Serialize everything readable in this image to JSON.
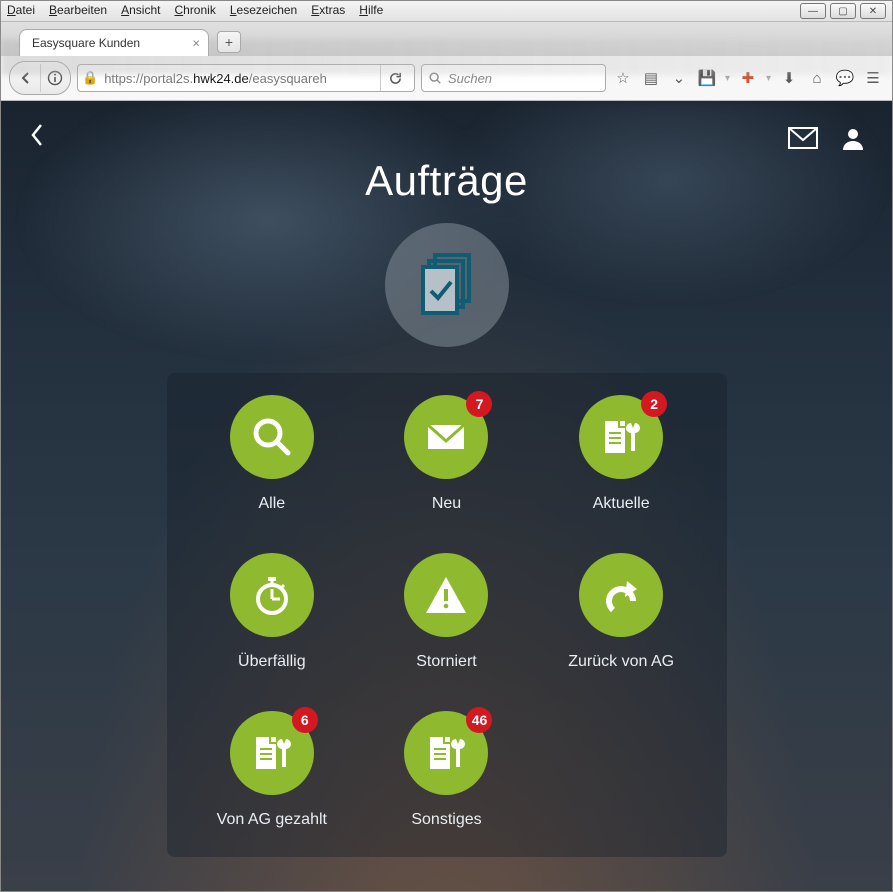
{
  "menubar": [
    "Datei",
    "Bearbeiten",
    "Ansicht",
    "Chronik",
    "Lesezeichen",
    "Extras",
    "Hilfe"
  ],
  "tab": {
    "title": "Easysquare Kunden"
  },
  "url": {
    "scheme": "https://",
    "host_pre": "portal2s.",
    "host": "hwk24.de",
    "path": "/easysquareh"
  },
  "search": {
    "placeholder": "Suchen"
  },
  "app": {
    "title": "Aufträge",
    "tiles": [
      {
        "id": "alle",
        "label": "Alle",
        "icon": "search",
        "badge": null
      },
      {
        "id": "neu",
        "label": "Neu",
        "icon": "envelope",
        "badge": "7"
      },
      {
        "id": "aktuelle",
        "label": "Aktuelle",
        "icon": "docwrench",
        "badge": "2"
      },
      {
        "id": "ueberfaellig",
        "label": "Überfällig",
        "icon": "stopwatch",
        "badge": null
      },
      {
        "id": "storniert",
        "label": "Storniert",
        "icon": "warning",
        "badge": null
      },
      {
        "id": "zurueck",
        "label": "Zurück von AG",
        "icon": "undo",
        "badge": null
      },
      {
        "id": "gezahlt",
        "label": "Von AG gezahlt",
        "icon": "docwrench",
        "badge": "6"
      },
      {
        "id": "sonstiges",
        "label": "Sonstiges",
        "icon": "docwrench",
        "badge": "46"
      }
    ]
  }
}
